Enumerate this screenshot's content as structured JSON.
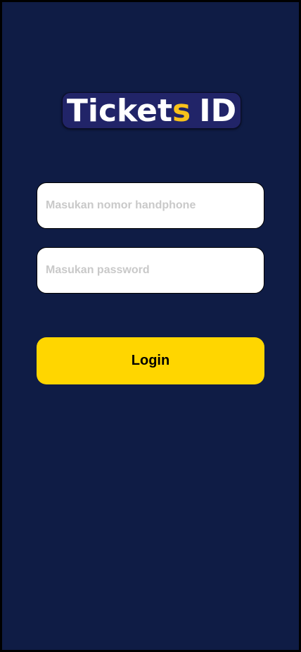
{
  "logo": {
    "part1": "Ticket",
    "accent": "s",
    "part2": "ID"
  },
  "form": {
    "phone_placeholder": "Masukan nomor handphone",
    "phone_value": "",
    "password_placeholder": "Masukan password",
    "password_value": "",
    "login_label": "Login"
  },
  "colors": {
    "background": "#0f1c45",
    "logo_bg": "#212468",
    "accent": "#f8c21a",
    "button": "#ffd600"
  }
}
